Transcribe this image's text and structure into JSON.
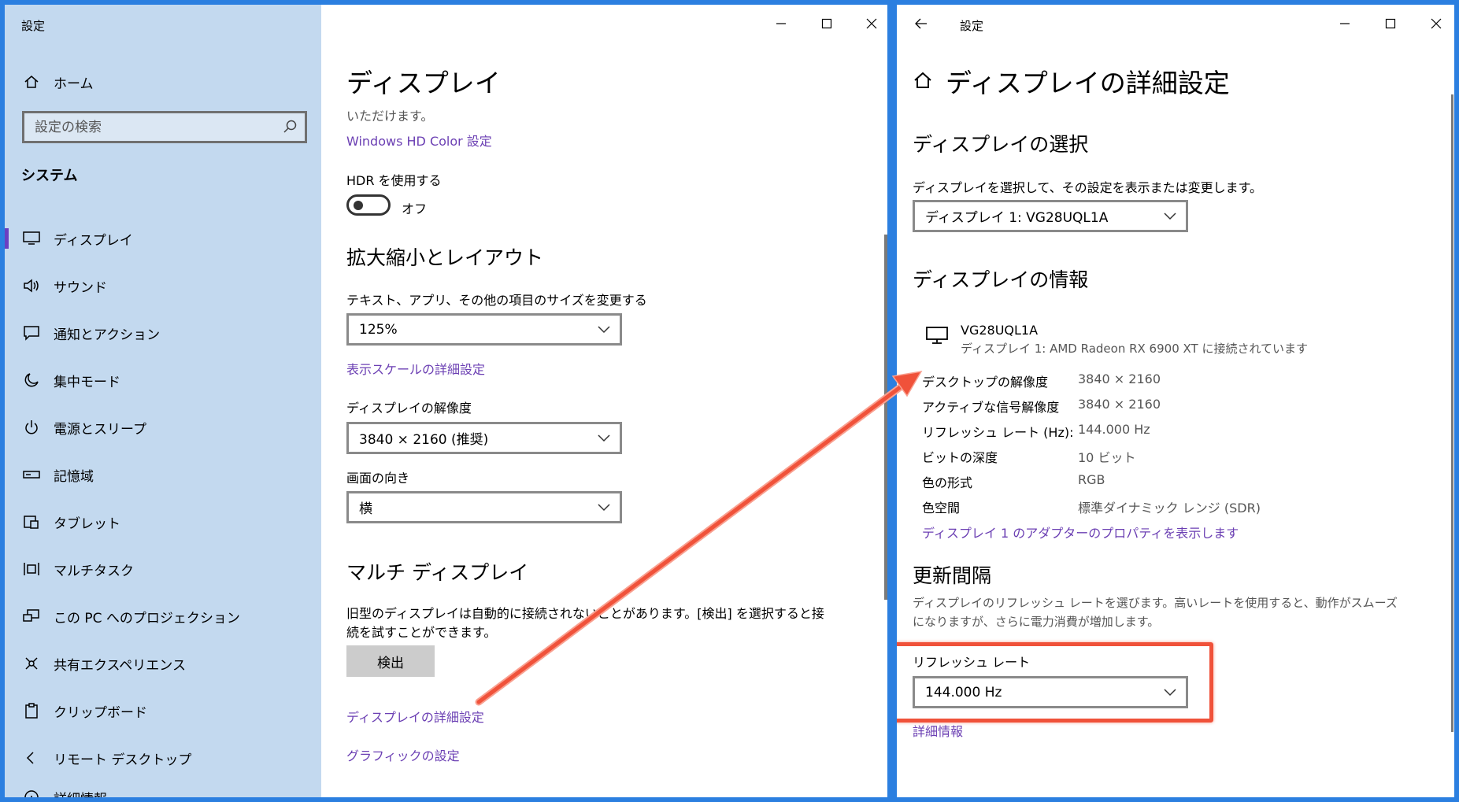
{
  "left_window": {
    "title": "設定",
    "sidebar": {
      "home": "ホーム",
      "search_placeholder": "設定の検索",
      "section": "システム",
      "items": [
        {
          "label": "ディスプレイ",
          "icon": "monitor-icon"
        },
        {
          "label": "サウンド",
          "icon": "speaker-icon"
        },
        {
          "label": "通知とアクション",
          "icon": "notification-icon"
        },
        {
          "label": "集中モード",
          "icon": "moon-icon"
        },
        {
          "label": "電源とスリープ",
          "icon": "power-icon"
        },
        {
          "label": "記憶域",
          "icon": "storage-icon"
        },
        {
          "label": "タブレット",
          "icon": "tablet-icon"
        },
        {
          "label": "マルチタスク",
          "icon": "multitask-icon"
        },
        {
          "label": "この PC へのプロジェクション",
          "icon": "projection-icon"
        },
        {
          "label": "共有エクスペリエンス",
          "icon": "share-icon"
        },
        {
          "label": "クリップボード",
          "icon": "clipboard-icon"
        },
        {
          "label": "リモート デスクトップ",
          "icon": "remote-icon"
        },
        {
          "label": "詳細情報",
          "icon": "info-icon"
        }
      ]
    },
    "main": {
      "title": "ディスプレイ",
      "partial_text": "いただけます。",
      "hd_color_link": "Windows HD Color 設定",
      "hdr_label": "HDR を使用する",
      "hdr_state": "オフ",
      "scale_heading": "拡大縮小とレイアウト",
      "scale_label": "テキスト、アプリ、その他の項目のサイズを変更する",
      "scale_value": "125%",
      "scale_link": "表示スケールの詳細設定",
      "resolution_label": "ディスプレイの解像度",
      "resolution_value": "3840 × 2160 (推奨)",
      "orientation_label": "画面の向き",
      "orientation_value": "横",
      "multi_heading": "マルチ ディスプレイ",
      "multi_text_1": "旧型のディスプレイは自動的に接続されないことがあります。[検出] を選択すると接",
      "multi_text_2": "続を試すことができます。",
      "detect_button": "検出",
      "advanced_link": "ディスプレイの詳細設定",
      "graphics_link": "グラフィックの設定"
    }
  },
  "right_window": {
    "title": "設定",
    "page_title": "ディスプレイの詳細設定",
    "select_heading": "ディスプレイの選択",
    "select_label": "ディスプレイを選択して、その設定を表示または変更します。",
    "select_value": "ディスプレイ 1: VG28UQL1A",
    "info_heading": "ディスプレイの情報",
    "monitor_name": "VG28UQL1A",
    "monitor_connection": "ディスプレイ 1: AMD Radeon RX 6900 XT に接続されています",
    "info_rows": [
      {
        "k": "デスクトップの解像度",
        "v": "3840 × 2160"
      },
      {
        "k": "アクティブな信号解像度",
        "v": "3840 × 2160"
      },
      {
        "k": "リフレッシュ レート (Hz):",
        "v": "144.000 Hz"
      },
      {
        "k": "ビットの深度",
        "v": "10 ビット"
      },
      {
        "k": "色の形式",
        "v": "RGB"
      },
      {
        "k": "色空間",
        "v": "標準ダイナミック レンジ (SDR)"
      }
    ],
    "adapter_link": "ディスプレイ 1 のアダプターのプロパティを表示します",
    "refresh_heading": "更新間隔",
    "refresh_desc_1": "ディスプレイのリフレッシュ レートを選びます。高いレートを使用すると、動作がスムーズ",
    "refresh_desc_2": "になりますが、さらに電力消費が増加します。",
    "refresh_label": "リフレッシュ レート",
    "refresh_value": "144.000 Hz",
    "details_link": "詳細情報"
  },
  "annotation": {
    "arrow_color": "#f0523a",
    "highlight_color": "#f0523a"
  }
}
